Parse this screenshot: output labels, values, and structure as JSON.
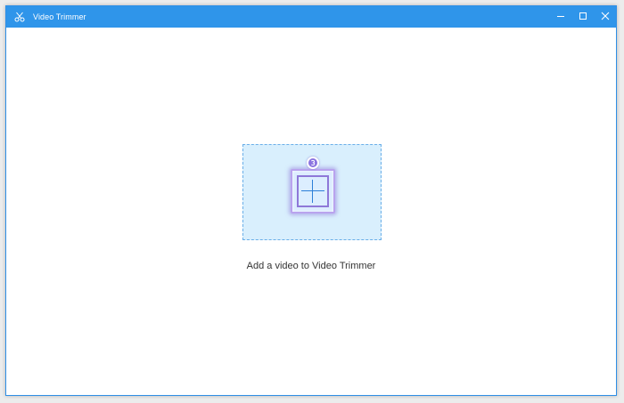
{
  "window": {
    "title": "Video Trimmer",
    "app_icon": "scissors-icon",
    "controls": [
      "minimize-icon",
      "maximize-icon",
      "close-icon"
    ]
  },
  "dropzone": {
    "add_icon": "plus-icon",
    "badge_icon": "step-number-badge",
    "hint": "Add a video to Video Trimmer"
  },
  "colors": {
    "titlebar": "#2f95ea",
    "dropzone_bg": "#d9effd",
    "dropzone_border": "#69aee8",
    "add_border": "#8e78d8",
    "badge": "#8a73e0"
  }
}
